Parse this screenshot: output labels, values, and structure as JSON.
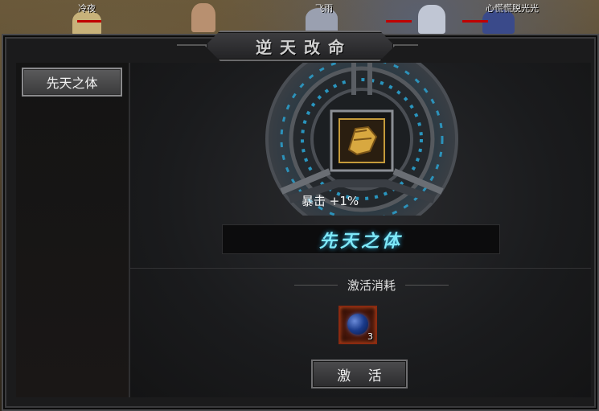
{
  "players": [
    {
      "name": "冷夜"
    },
    {
      "name": "飞雨"
    },
    {
      "name": "心慌慌脱光光"
    }
  ],
  "window": {
    "title": "逆天改命"
  },
  "sidebar": {
    "items": [
      {
        "label": "先天之体"
      }
    ]
  },
  "talent": {
    "icon": "gold-gauntlet-icon",
    "stat": "暴击 +1%",
    "name": "先天之体"
  },
  "cost": {
    "label": "激活消耗",
    "item_icon": "blue-orb-icon",
    "item_count": "3"
  },
  "actions": {
    "activate_label": "激 活"
  },
  "colors": {
    "name_glow": "#7ee8f8",
    "rune_blue": "#2aa8d8",
    "cost_border": "#8a2a10"
  }
}
